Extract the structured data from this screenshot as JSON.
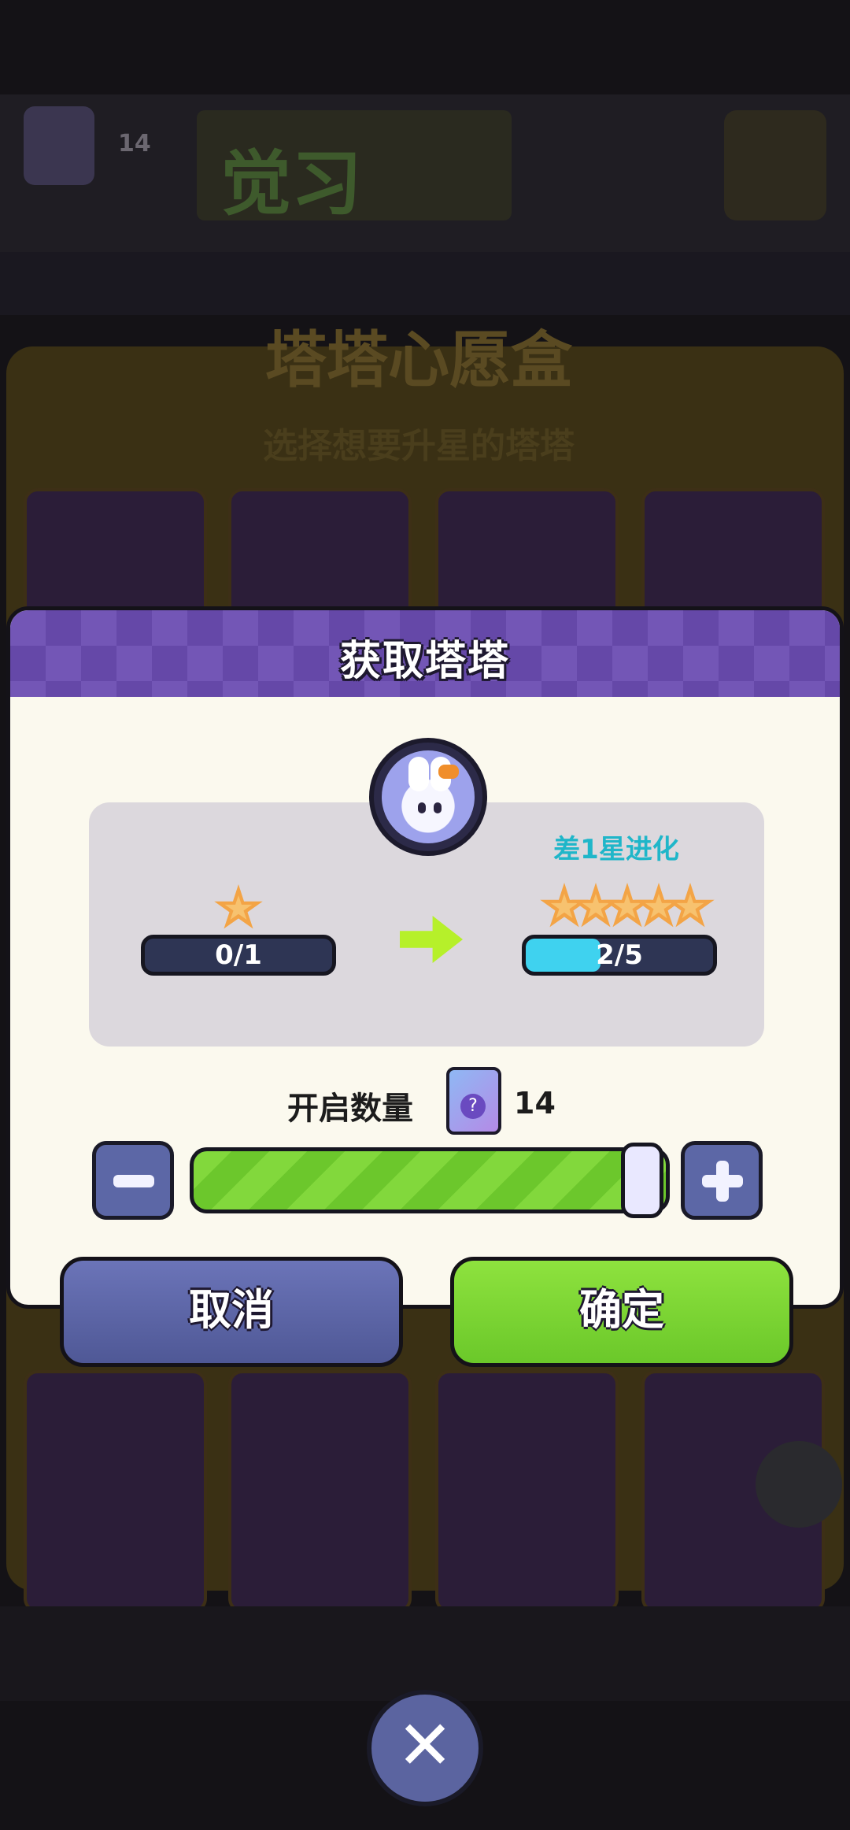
{
  "background": {
    "box_count": "14",
    "banner_text": "觉习",
    "panel_title": "塔塔心愿盒",
    "panel_subtitle": "选择想要升星的塔塔"
  },
  "dialog": {
    "title": "获取塔塔",
    "current": {
      "progress_text": "0/1",
      "stars": 1
    },
    "next": {
      "evolve_label": "差1星进化",
      "progress_text": "2/5",
      "progress_fraction": 0.4,
      "stars": 5
    },
    "quantity": {
      "label": "开启数量",
      "box_count": "14",
      "box_icon": "mystery-box-icon",
      "slider_fraction": 1.0
    },
    "buttons": {
      "cancel": "取消",
      "confirm": "确定"
    }
  },
  "close_glyph": "✕",
  "colors": {
    "header_purple": "#7356b6",
    "confirm_green": "#82d83c",
    "cancel_blue": "#5c67a6",
    "progress_cyan": "#3fd2ef",
    "star_orange": "#f3a446",
    "evolve_text": "#1fb6c9"
  }
}
